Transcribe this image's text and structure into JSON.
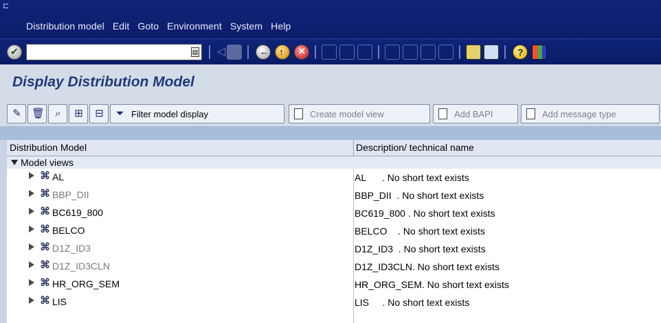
{
  "menu": {
    "items": [
      "Distribution model",
      "Edit",
      "Goto",
      "Environment",
      "System",
      "Help"
    ]
  },
  "toolbar": {
    "command_value": "",
    "icons": [
      "enter-icon",
      "back-icon",
      "exit-icon",
      "cancel-icon",
      "print-icon",
      "find-icon",
      "find-next-icon",
      "first-page-icon",
      "prev-page-icon",
      "next-page-icon",
      "last-page-icon",
      "new-session-icon",
      "shortcut-icon",
      "help-icon",
      "layout-icon"
    ]
  },
  "title": "Display Distribution Model",
  "app_toolbar": {
    "filter_label": "Filter model display",
    "create_label": "Create model view",
    "add_bapi_label": "Add BAPI",
    "add_message_label": "Add message type"
  },
  "tree": {
    "columns": [
      "Distribution Model",
      "Description/ technical name"
    ],
    "group_label": "Model views",
    "rows": [
      {
        "name": "AL",
        "desc": "AL      . No short text exists",
        "greyed": false
      },
      {
        "name": "BBP_DII",
        "desc": "BBP_DII  . No short text exists",
        "greyed": true
      },
      {
        "name": "BC619_800",
        "desc": "BC619_800 . No short text exists",
        "greyed": false
      },
      {
        "name": "BELCO",
        "desc": "BELCO    . No short text exists",
        "greyed": false
      },
      {
        "name": "D1Z_ID3",
        "desc": "D1Z_ID3  . No short text exists",
        "greyed": true
      },
      {
        "name": "D1Z_ID3CLN",
        "desc": "D1Z_ID3CLN. No short text exists",
        "greyed": true
      },
      {
        "name": "HR_ORG_SEM",
        "desc": "HR_ORG_SEM. No short text exists",
        "greyed": false
      },
      {
        "name": "LIS",
        "desc": "LIS     . No short text exists",
        "greyed": false
      }
    ]
  },
  "colors": {
    "title_bar": "#11237a",
    "title_text": "#1f3a78",
    "background": "#d4dce8"
  }
}
